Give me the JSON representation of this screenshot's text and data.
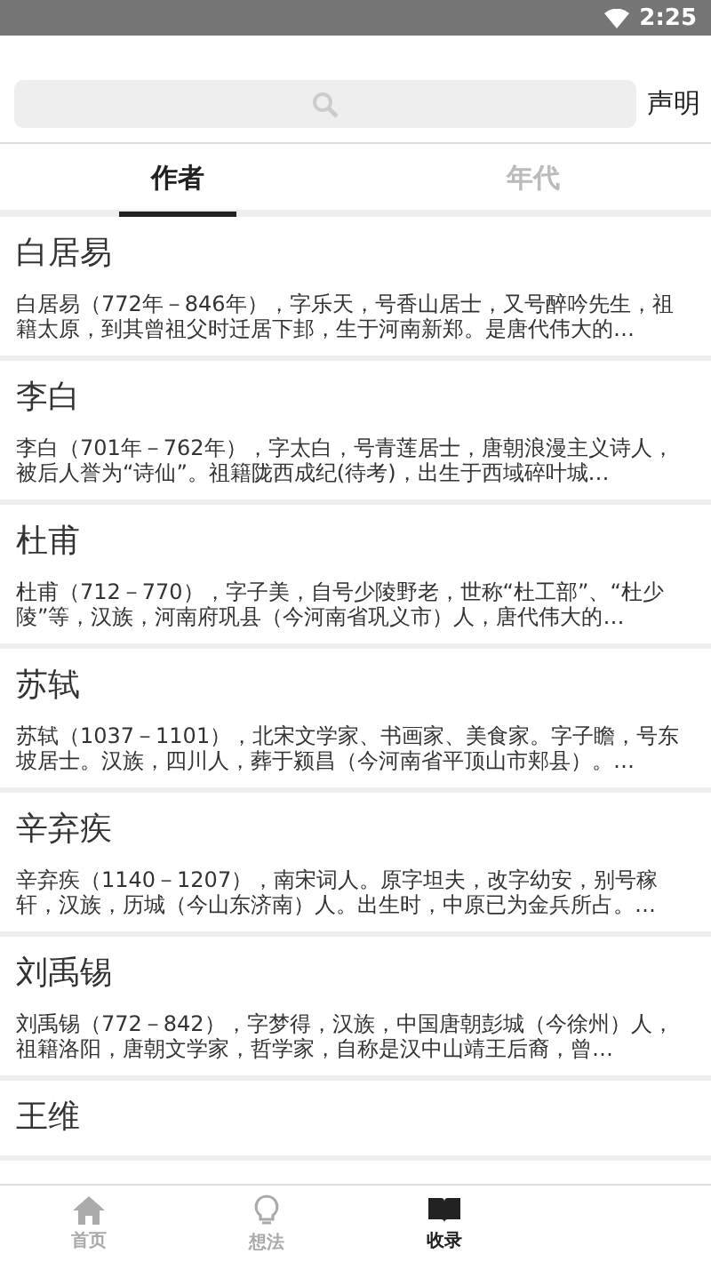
{
  "status_bar": {
    "time": "2:25"
  },
  "search": {
    "action": "声明"
  },
  "tabs": [
    {
      "label": "作者",
      "selected": true
    },
    {
      "label": "年代",
      "selected": false
    }
  ],
  "authors": [
    {
      "name": "白居易",
      "summary": "白居易（772年－846年），字乐天，号香山居士，又号醉吟先生，祖籍太原，到其曾祖父时迁居下邽，生于河南新郑。是唐代伟大的…"
    },
    {
      "name": "李白",
      "summary": "李白（701年－762年），字太白，号青莲居士，唐朝浪漫主义诗人，被后人誉为“诗仙”。祖籍陇西成纪(待考)，出生于西域碎叶城…"
    },
    {
      "name": "杜甫",
      "summary": "杜甫（712－770），字子美，自号少陵野老，世称“杜工部”、“杜少陵”等，汉族，河南府巩县（今河南省巩义市）人，唐代伟大的…"
    },
    {
      "name": "苏轼",
      "summary": "苏轼（1037－1101），北宋文学家、书画家、美食家。字子瞻，号东坡居士。汉族，四川人，葬于颍昌（今河南省平顶山市郏县）。…"
    },
    {
      "name": "辛弃疾",
      "summary": "辛弃疾（1140－1207），南宋词人。原字坦夫，改字幼安，别号稼轩，汉族，历城（今山东济南）人。出生时，中原已为金兵所占。…"
    },
    {
      "name": "刘禹锡",
      "summary": "刘禹锡（772－842），字梦得，汉族，中国唐朝彭城（今徐州）人，祖籍洛阳，唐朝文学家，哲学家，自称是汉中山靖王后裔，曾…"
    },
    {
      "name": "王维"
    }
  ],
  "bottom_nav": [
    {
      "label": "首页",
      "kind": "home",
      "selected": false
    },
    {
      "label": "想法",
      "kind": "idea",
      "selected": false
    },
    {
      "label": "收录",
      "kind": "book",
      "selected": true
    }
  ]
}
